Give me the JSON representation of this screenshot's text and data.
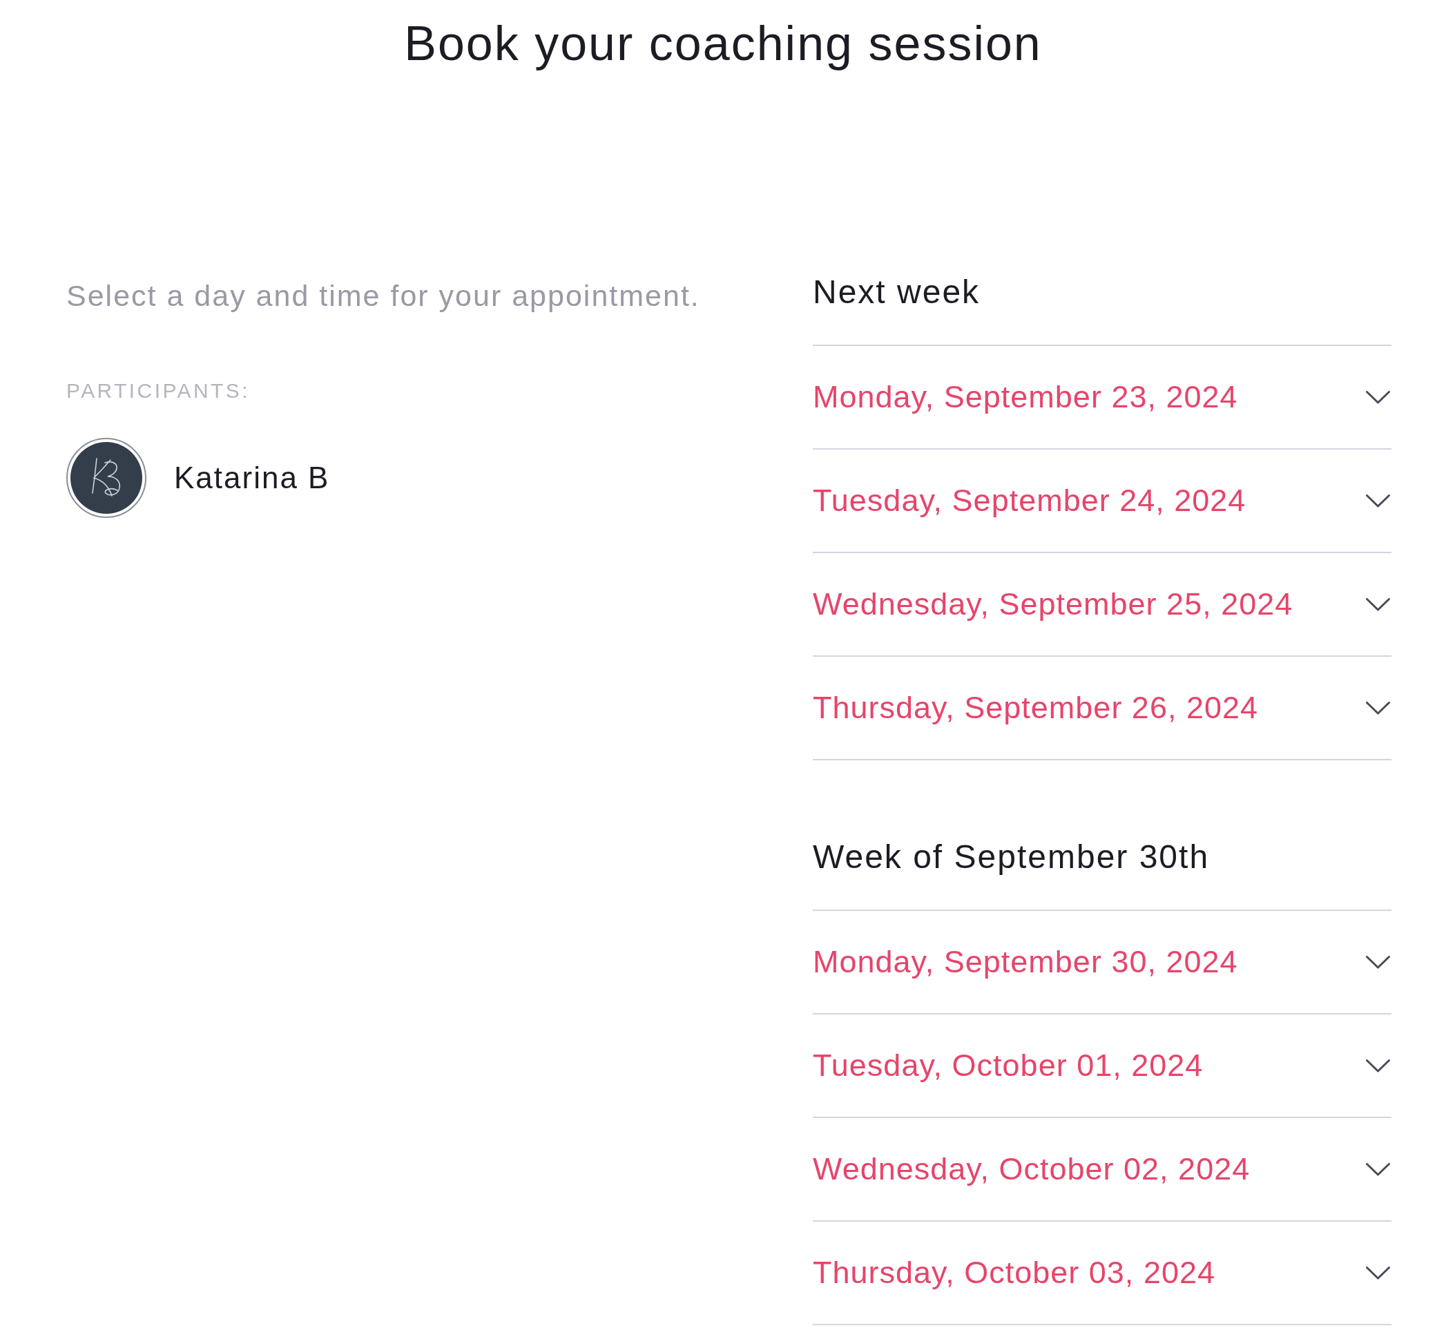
{
  "title": "Book your coaching session",
  "intro": "Select a day and time for your appointment.",
  "participants": {
    "label": "PARTICIPANTS:",
    "people": [
      {
        "name": "Katarina B"
      }
    ]
  },
  "weeks": [
    {
      "heading": "Next week",
      "days": [
        {
          "date": "Monday, September 23, 2024",
          "expanded": false
        },
        {
          "date": "Tuesday, September 24, 2024",
          "expanded": false
        },
        {
          "date": "Wednesday, September 25, 2024",
          "expanded": false
        },
        {
          "date": "Thursday, September 26, 2024",
          "expanded": false
        }
      ]
    },
    {
      "heading": "Week of September 30th",
      "days": [
        {
          "date": "Monday, September 30, 2024",
          "expanded": false
        },
        {
          "date": "Tuesday, October 01, 2024",
          "expanded": false
        },
        {
          "date": "Wednesday, October 02, 2024",
          "expanded": false
        },
        {
          "date": "Thursday, October 03, 2024",
          "expanded": false
        }
      ]
    }
  ]
}
